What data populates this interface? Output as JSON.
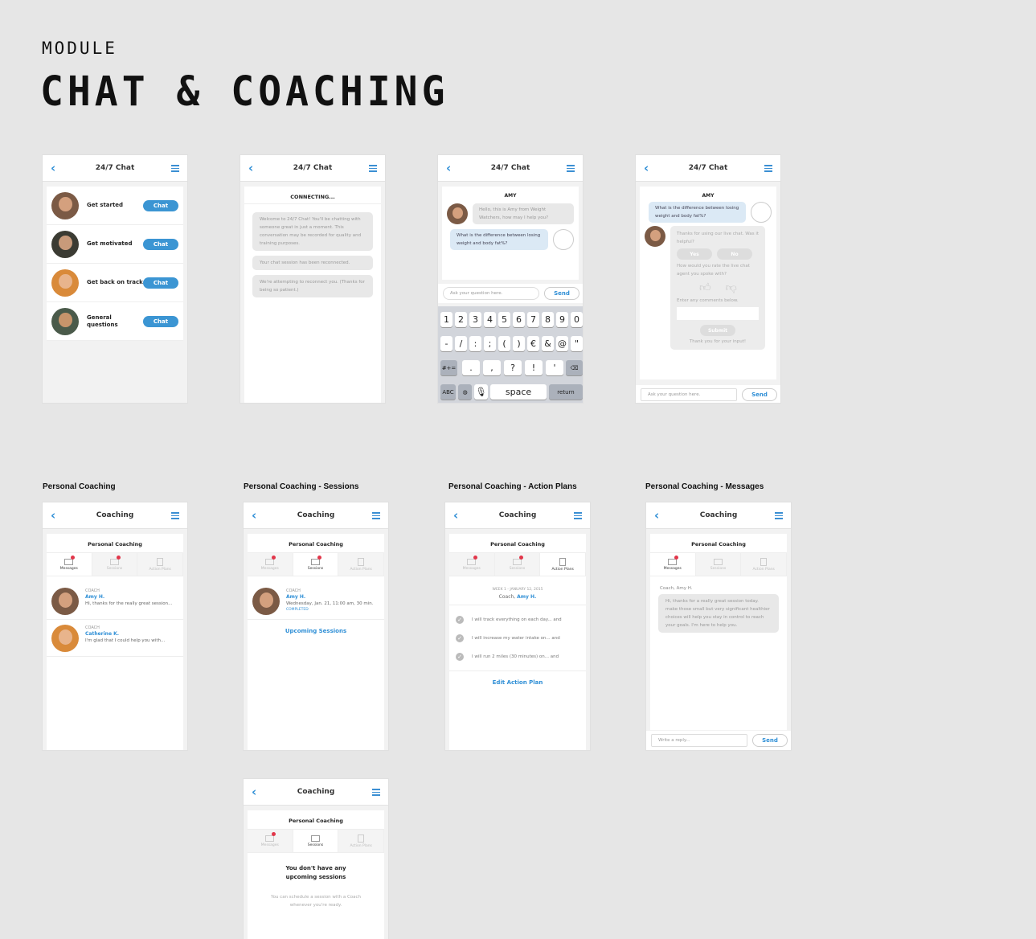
{
  "header": {
    "module": "MODULE",
    "title": "CHAT & COACHING"
  },
  "chat": {
    "title": "24/7 Chat",
    "options": [
      {
        "label": "Get started",
        "btn": "Chat"
      },
      {
        "label": "Get motivated",
        "btn": "Chat"
      },
      {
        "label": "Get back on track",
        "btn": "Chat"
      },
      {
        "label": "General questions",
        "btn": "Chat"
      }
    ],
    "connecting": "CONNECTING...",
    "msg1": "Welcome to 24/7 Chat! You'll be chatting with someone great in just a moment. This conversation may be recorded for quality and training purposes.",
    "msg2": "Your chat session has been reconnected.",
    "msg3": "We're attempting to reconnect you. (Thanks for being so patient.)",
    "agent": "AMY",
    "agent_msg": "Hello, this is Amy from Weight Watchers, how may I help you?",
    "user_msg": "What is the difference between losing weight and body fat%?",
    "placeholder": "Ask your question here.",
    "send": "Send",
    "survey": {
      "thanks": "Thanks for using our live chat. Was it helpful?",
      "yes": "Yes",
      "no": "No",
      "rate": "How would you rate the live chat agent you spoke with?",
      "comments": "Enter any comments below.",
      "submit": "Submit",
      "footer": "Thank you for your input!"
    },
    "keyboard": {
      "row1": [
        "1",
        "2",
        "3",
        "4",
        "5",
        "6",
        "7",
        "8",
        "9",
        "0"
      ],
      "row2": [
        "-",
        "/",
        ":",
        ";",
        "(",
        ")",
        "€",
        "&",
        "@",
        "\""
      ],
      "row3": [
        ".",
        ",",
        "?",
        "!",
        "'"
      ],
      "sym": "#+=",
      "abc": "ABC",
      "space": "space",
      "return": "return"
    }
  },
  "coaching": {
    "captions": [
      "Personal Coaching",
      "Personal Coaching - Sessions",
      "Personal Coaching - Action Plans",
      "Personal Coaching - Messages"
    ],
    "title": "Coaching",
    "sub": "Personal Coaching",
    "tabs": [
      "Messages",
      "Sessions",
      "Action Plans"
    ],
    "coach_role": "COACH",
    "c1_name": "Amy H.",
    "c1_msg": "Hi, thanks for the really great session...",
    "c2_name": "Catherine K.",
    "c2_msg": "I'm glad that I could help you with...",
    "session_date": "Wednesday, Jan. 21, 11:00 am, 30 min.",
    "session_status": "COMPLETED",
    "upcoming": "Upcoming Sessions",
    "week": "WEEK 1 - JANUARY 12, 2015",
    "coach_prefix": "Coach,",
    "plans": [
      "I will track everything on each day... and",
      "I will increase my water intake on... and",
      "I will run 2 miles (30 minutes) on... and"
    ],
    "edit": "Edit Action Plan",
    "msg_from": "Coach, Amy H.",
    "msg_body": "Hi, thanks for a really great session today. make those small but very significant healthier choices will help you stay in control to reach your goals. I'm here to help you.",
    "reply": "Write a reply...",
    "none_title": "You don't have any upcoming sessions",
    "none_body": "You can schedule a session with a Coach whenever you're ready."
  }
}
